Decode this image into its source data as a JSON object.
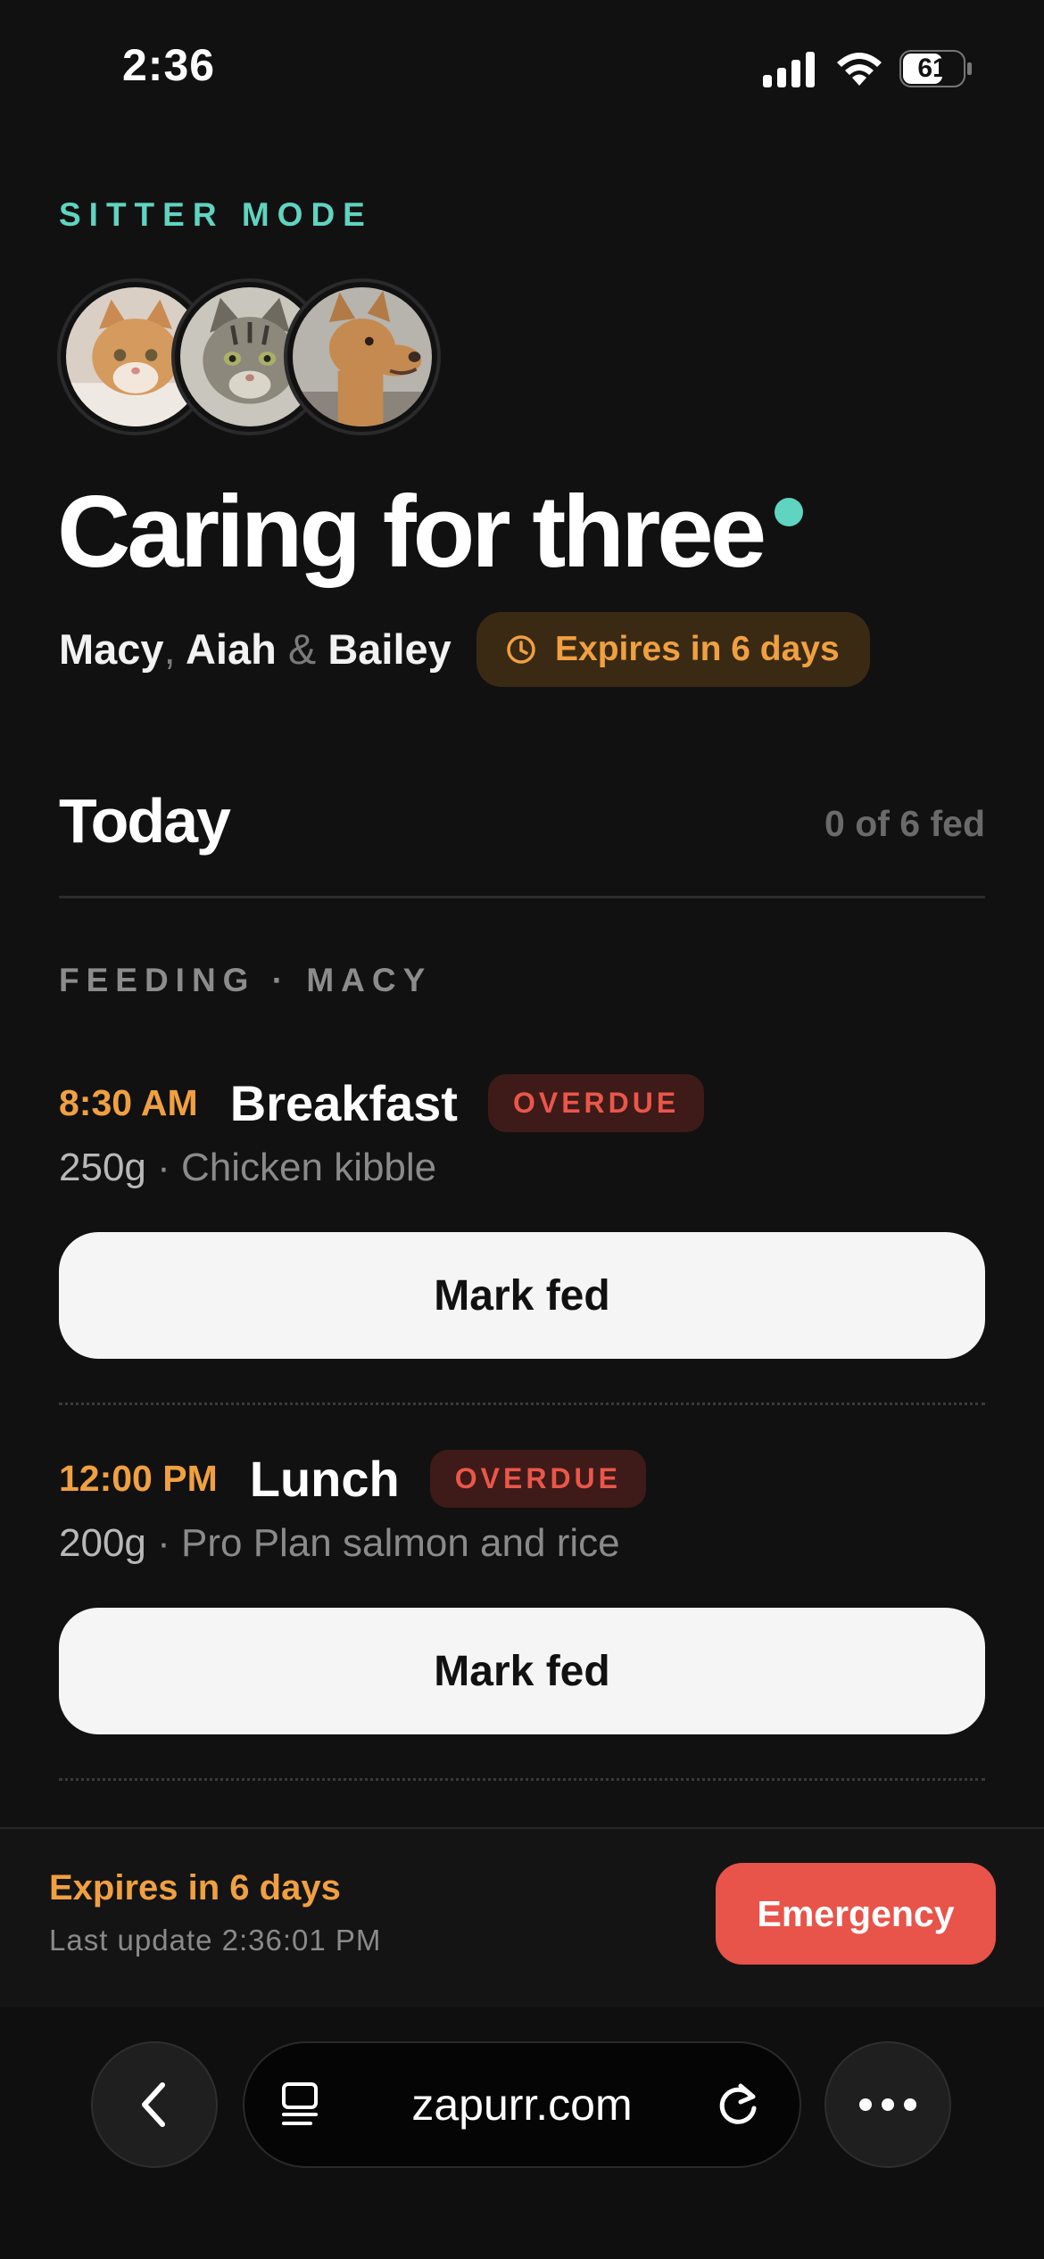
{
  "status_bar": {
    "time": "2:36",
    "battery": "61"
  },
  "header": {
    "eyebrow": "SITTER MODE",
    "title": "Caring for three",
    "pets": [
      "Macy",
      "Aiah",
      "Bailey"
    ],
    "name_separator_1": ",",
    "name_separator_2": "&",
    "expiry_badge": "Expires in 6 days"
  },
  "today": {
    "heading": "Today",
    "fed_count": "0 of 6 fed",
    "section_label": "FEEDING · MACY",
    "meals": [
      {
        "time": "8:30 AM",
        "name": "Breakfast",
        "status": "OVERDUE",
        "amount": "250g",
        "food": "· Chicken kibble",
        "button": "Mark fed"
      },
      {
        "time": "12:00 PM",
        "name": "Lunch",
        "status": "OVERDUE",
        "amount": "200g",
        "food": "· Pro Plan salmon and rice",
        "button": "Mark fed"
      }
    ]
  },
  "footer": {
    "expiry": "Expires in 6 days",
    "last_update": "Last update 2:36:01 PM",
    "emergency_button": "Emergency"
  },
  "browser": {
    "url": "zapurr.com"
  },
  "colors": {
    "accent": "#5fd4c0",
    "warning": "#f0a040",
    "danger": "#e8534a",
    "background": "#111111"
  }
}
